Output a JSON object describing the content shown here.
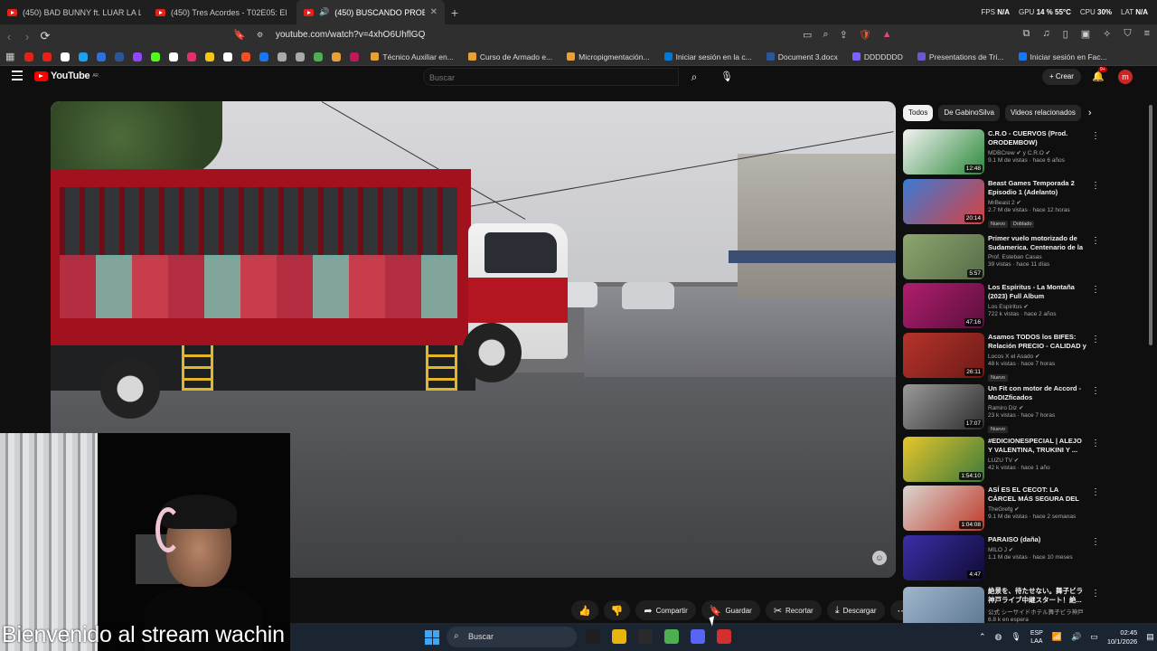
{
  "browser": {
    "tabs": [
      {
        "title": "(450) BAD BUNNY ft. LUAR LA L - TE",
        "active": false
      },
      {
        "title": "(450) Tres Acordes - T02E05: El Resum",
        "active": false
      },
      {
        "title": "(450) BUSCANDO PROBLEMA",
        "active": true
      }
    ],
    "new_tab": "+",
    "sysmon": {
      "fps_label": "FPS",
      "fps": "N/A",
      "gpu_label": "GPU",
      "gpu": "14 % 55°C",
      "cpu_label": "CPU",
      "cpu": "30%",
      "lat_label": "LAT",
      "lat": "N/A"
    },
    "url": "youtube.com/watch?v=4xhO6UhflGQ"
  },
  "bookmarks": [
    {
      "label": "Técnico Auxiliar en...",
      "color": "#e8a13a"
    },
    {
      "label": "Curso de Armado e...",
      "color": "#e8a13a"
    },
    {
      "label": "Micropigmentación...",
      "color": "#e8a13a"
    },
    {
      "label": "Iniciar sesión en la c...",
      "color": "#0078d4"
    },
    {
      "label": "Document 3.docx",
      "color": "#2b579a"
    },
    {
      "label": "DDDDDDD",
      "color": "#7b61ff"
    },
    {
      "label": "Presentations de Tri...",
      "color": "#6a5acd"
    },
    {
      "label": "Iniciar sesión en Fac...",
      "color": "#1877f2"
    }
  ],
  "bookmark_icons": [
    "#e62117",
    "#e62117",
    "#ffffff",
    "#1da1f2",
    "#2f6fdd",
    "#2b579a",
    "#9146ff",
    "#53fc18",
    "#ffffff",
    "#e1306c",
    "#f2c811",
    "#ffffff",
    "#f25022",
    "#1877f2",
    "#aaaaaa",
    "#aaaaaa",
    "#4caf50",
    "#e8a13a",
    "#c2185b"
  ],
  "youtube": {
    "logo": "YouTube",
    "country": "AR",
    "search_placeholder": "Buscar",
    "create_label": "Crear",
    "notifications": "9+",
    "avatar_letter": "m"
  },
  "actions": [
    {
      "name": "like-button",
      "icon": "👍",
      "label": ""
    },
    {
      "name": "dislike-button",
      "icon": "👎",
      "label": ""
    },
    {
      "name": "share-button",
      "icon": "➦",
      "label": "Compartir"
    },
    {
      "name": "save-button",
      "icon": "🔖",
      "label": "Guardar"
    },
    {
      "name": "clip-button",
      "icon": "✂",
      "label": "Recortar"
    },
    {
      "name": "download-button",
      "icon": "⤓",
      "label": "Descargar"
    },
    {
      "name": "more-actions-button",
      "icon": "⋯",
      "label": ""
    }
  ],
  "caption": "Bienvenido al stream wachin",
  "sidebar": {
    "chips": [
      "Todos",
      "De GabinoSilva",
      "Videos relacionados"
    ],
    "items": [
      {
        "title": "C.R.O - CUERVOS (Prod. ORODEMBOW)",
        "channel": "MDBCrew ✔ y C.R.O ✔",
        "stats": "9.1 M de vistas · hace 6 años",
        "duration": "12:48",
        "badges": [],
        "thumb": [
          "#f2f2f2",
          "#2c8a3c"
        ]
      },
      {
        "title": "Beast Games Temporada 2 Episodio 1 (Adelanto)",
        "channel": "MrBeast 2 ✔",
        "stats": "2.7 M de vistas · hace 12 horas",
        "duration": "20:14",
        "badges": [
          "Nuevo",
          "Doblado"
        ],
        "thumb": [
          "#3a7bd5",
          "#d94040"
        ]
      },
      {
        "title": "Primer vuelo motorizado de Sudamerica. Centenario de la ...",
        "channel": "Prof. Esteban Casas",
        "stats": "39 vistas · hace 11 días",
        "duration": "5:57",
        "badges": [],
        "thumb": [
          "#8da66e",
          "#566b48"
        ]
      },
      {
        "title": "Los Espíritus - La Montaña (2023) Full Album",
        "channel": "Los Espíritus ✔",
        "stats": "722 k vistas · hace 2 años",
        "duration": "47:16",
        "badges": [],
        "thumb": [
          "#b01e6e",
          "#5a0f3d"
        ]
      },
      {
        "title": "Asamos TODOS los BIFES: Relación PRECIO - CALIDAD y ...",
        "channel": "Locos X el Asado ✔",
        "stats": "48 k vistas · hace 7 horas",
        "duration": "26:11",
        "badges": [
          "Nuevo"
        ],
        "thumb": [
          "#b5342c",
          "#6e1a16"
        ]
      },
      {
        "title": "Un Fit con motor de Accord - MoDIZficados",
        "channel": "Ramiro Diz ✔",
        "stats": "23 k vistas · hace 7 horas",
        "duration": "17:07",
        "badges": [
          "Nuevo"
        ],
        "thumb": [
          "#9a9a9a",
          "#2d2d2d"
        ]
      },
      {
        "title": "#EDICIONESPECIAL | ALEJO Y VALENTINA, TRUKINI Y ...",
        "channel": "LUZU TV ✔",
        "stats": "42 k vistas · hace 1 año",
        "duration": "1:54:10",
        "badges": [],
        "thumb": [
          "#e7c62b",
          "#3b7a3b"
        ]
      },
      {
        "title": "ASÍ ES EL CECOT: LA CÁRCEL MÁS SEGURA DEL MUNDO",
        "channel": "TheGrefg ✔",
        "stats": "9.1 M de vistas · hace 2 semanas",
        "duration": "1:04:08",
        "badges": [],
        "thumb": [
          "#d9d6cf",
          "#c0392b"
        ]
      },
      {
        "title": "PARAISO (daña)",
        "channel": "MILO J ✔",
        "stats": "1.1 M de vistas · hace 10 meses",
        "duration": "4:47",
        "badges": [],
        "thumb": [
          "#3b2fa8",
          "#0f0b35"
        ]
      },
      {
        "title": "絶景を、待たせない。舞子ビラ 神戸ライブ中継スタート！絶...",
        "channel": "公式 シーサイドホテル舞子ビラ神戸",
        "stats": "6.8 k en espera",
        "duration": "",
        "badges": [],
        "thumb": [
          "#9fb6cc",
          "#5c7690"
        ]
      }
    ]
  },
  "taskbar": {
    "search_label": "Buscar",
    "lang": [
      "ESP",
      "LAA"
    ],
    "time": "02:45",
    "date": "10/1/2026",
    "apps": [
      "#1f1f1f",
      "#e8b40f",
      "#2a2a2a",
      "#4caf50",
      "#5865f2",
      "#d32f2f"
    ]
  }
}
